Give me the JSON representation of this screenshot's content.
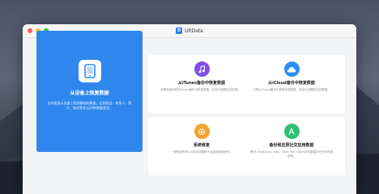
{
  "window": {
    "title": "UltData",
    "logo_letter": "D"
  },
  "hero": {
    "title": "从设备上恢复数据",
    "description": "支持直接从设备上找到删除的数据，比如短信、联系人、照片、微信等多达35种数据类型。"
  },
  "cards": [
    {
      "title": "从iTunes备份中恢复数据",
      "description": "无需连接到你的iTunes备份中恢复数据，包含已经删除过的数据。",
      "icon": "music-icon",
      "color": "#7e4fe6"
    },
    {
      "title": "从iCloud备份中恢复数据",
      "description": "无需从iCloud备份中获取恢复数据，包含已经删除过的数据。",
      "icon": "cloud-icon",
      "color": "#2d8ff0"
    },
    {
      "title": "系统修复",
      "description": "一键修复所有iOS系统问题而不会造成数据丢失。",
      "icon": "gear-icon",
      "color": "#f2a52e"
    },
    {
      "title": "备份和还原社交应用数据",
      "description": "备份 WhatsApp, LINE, Viber, Kik, Wechat的数据并在任何时候还原。",
      "icon": "app-store-icon",
      "color": "#2fbf71"
    }
  ]
}
